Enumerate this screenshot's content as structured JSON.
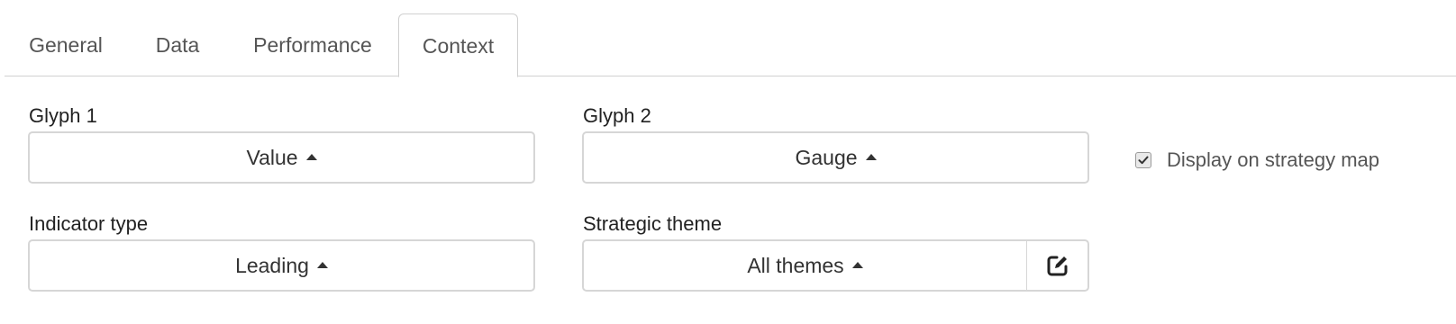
{
  "tabs": [
    {
      "label": "General",
      "active": false
    },
    {
      "label": "Data",
      "active": false
    },
    {
      "label": "Performance",
      "active": false
    },
    {
      "label": "Context",
      "active": true
    }
  ],
  "glyph1": {
    "label": "Glyph 1",
    "value": "Value"
  },
  "glyph2": {
    "label": "Glyph 2",
    "value": "Gauge"
  },
  "display_on_map": {
    "label": "Display on strategy map",
    "checked": true
  },
  "indicator_type": {
    "label": "Indicator type",
    "value": "Leading"
  },
  "strategic_theme": {
    "label": "Strategic theme",
    "value": "All themes",
    "edit_icon": "edit-icon"
  },
  "colors": {
    "border": "#d6d6d6",
    "text": "#333333",
    "tab_text": "#555555"
  }
}
